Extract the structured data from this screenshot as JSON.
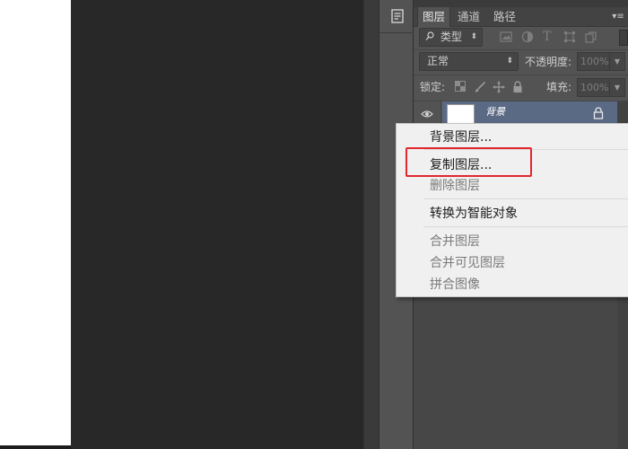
{
  "tabs": [
    {
      "label": "图层",
      "active": true
    },
    {
      "label": "通道",
      "active": false
    },
    {
      "label": "路径",
      "active": false
    }
  ],
  "filter": {
    "label": "类型",
    "icon": "search-icon"
  },
  "blend": {
    "mode": "正常"
  },
  "opacity": {
    "label": "不透明度:",
    "value": "100%"
  },
  "lock": {
    "label": "锁定:"
  },
  "fill": {
    "label": "填充:",
    "value": "100%"
  },
  "layer": {
    "name": "背景"
  },
  "context_menu": {
    "items": [
      {
        "label": "背景图层...",
        "enabled": true
      },
      {
        "label": "复制图层...",
        "enabled": true,
        "highlighted": true
      },
      {
        "label": "删除图层",
        "enabled": false
      },
      {
        "label": "转换为智能对象",
        "enabled": true
      },
      {
        "label": "合并图层",
        "enabled": false
      },
      {
        "label": "合并可见图层",
        "enabled": false
      },
      {
        "label": "拼合图像",
        "enabled": false
      }
    ]
  },
  "colors": {
    "selected_layer": "#5a6a84",
    "highlight": "#e0282e",
    "panel_bg": "#535353",
    "workspace": "#282828"
  }
}
